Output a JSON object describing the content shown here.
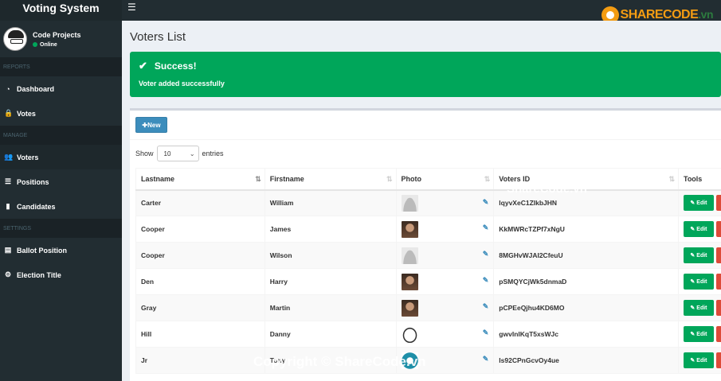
{
  "app": {
    "title": "Voting System",
    "menu_icon": "hamburger-icon",
    "logo": {
      "text": "SHARECODE",
      "suffix": ".vn",
      "icon": "sharecode-logo-icon"
    }
  },
  "sidebar": {
    "user": {
      "name": "Code Projects",
      "status": "Online"
    },
    "sections": [
      {
        "header": "REPORTS",
        "items": [
          {
            "label": "Dashboard",
            "icon": "dashboard-icon",
            "glyph": "◔"
          },
          {
            "label": "Votes",
            "icon": "lock-icon",
            "glyph": "🔒"
          }
        ]
      },
      {
        "header": "MANAGE",
        "items": [
          {
            "label": "Voters",
            "icon": "users-icon",
            "glyph": "👥",
            "active": true
          },
          {
            "label": "Positions",
            "icon": "tasks-icon",
            "glyph": "☰"
          },
          {
            "label": "Candidates",
            "icon": "black-tie-icon",
            "glyph": "▮"
          }
        ]
      },
      {
        "header": "SETTINGS",
        "items": [
          {
            "label": "Ballot Position",
            "icon": "file-text-icon",
            "glyph": "▤"
          },
          {
            "label": "Election Title",
            "icon": "cog-icon",
            "glyph": "⚙"
          }
        ]
      }
    ]
  },
  "page": {
    "title": "Voters List",
    "alert": {
      "heading": "Success!",
      "message": "Voter added successfully",
      "color": "#00a65a"
    },
    "new_button": "New",
    "show_label": "Show",
    "entries_label": "entries",
    "length_value": "10"
  },
  "table": {
    "columns": [
      "Lastname",
      "Firstname",
      "Photo",
      "Voters ID",
      "Tools"
    ],
    "edit_label": "Edit",
    "rows": [
      {
        "lastname": "Carter",
        "firstname": "William",
        "photo": "profile-placeholder",
        "voters_id": "lqyvXeC1ZIkbJHN"
      },
      {
        "lastname": "Cooper",
        "firstname": "James",
        "photo": "person-photo",
        "voters_id": "KkMWRcTZPf7xNgU"
      },
      {
        "lastname": "Cooper",
        "firstname": "Wilson",
        "photo": "profile-placeholder",
        "voters_id": "8MGHvWJAI2CfeuU"
      },
      {
        "lastname": "Den",
        "firstname": "Harry",
        "photo": "person-photo",
        "voters_id": "pSMQYCjWk5dnmaD"
      },
      {
        "lastname": "Gray",
        "firstname": "Martin",
        "photo": "person-photo",
        "voters_id": "pCPEeQjhu4KD6MO"
      },
      {
        "lastname": "Hill",
        "firstname": "Danny",
        "photo": "trollface-photo",
        "voters_id": "gwvInlKqT5xsWJc"
      },
      {
        "lastname": "Jr",
        "firstname": "Tony",
        "photo": "logo-photo",
        "voters_id": "Is92CPnGcvOy4ue"
      }
    ]
  },
  "watermarks": [
    "ShareCode.vn",
    "Copyright © ShareCode.vn"
  ]
}
